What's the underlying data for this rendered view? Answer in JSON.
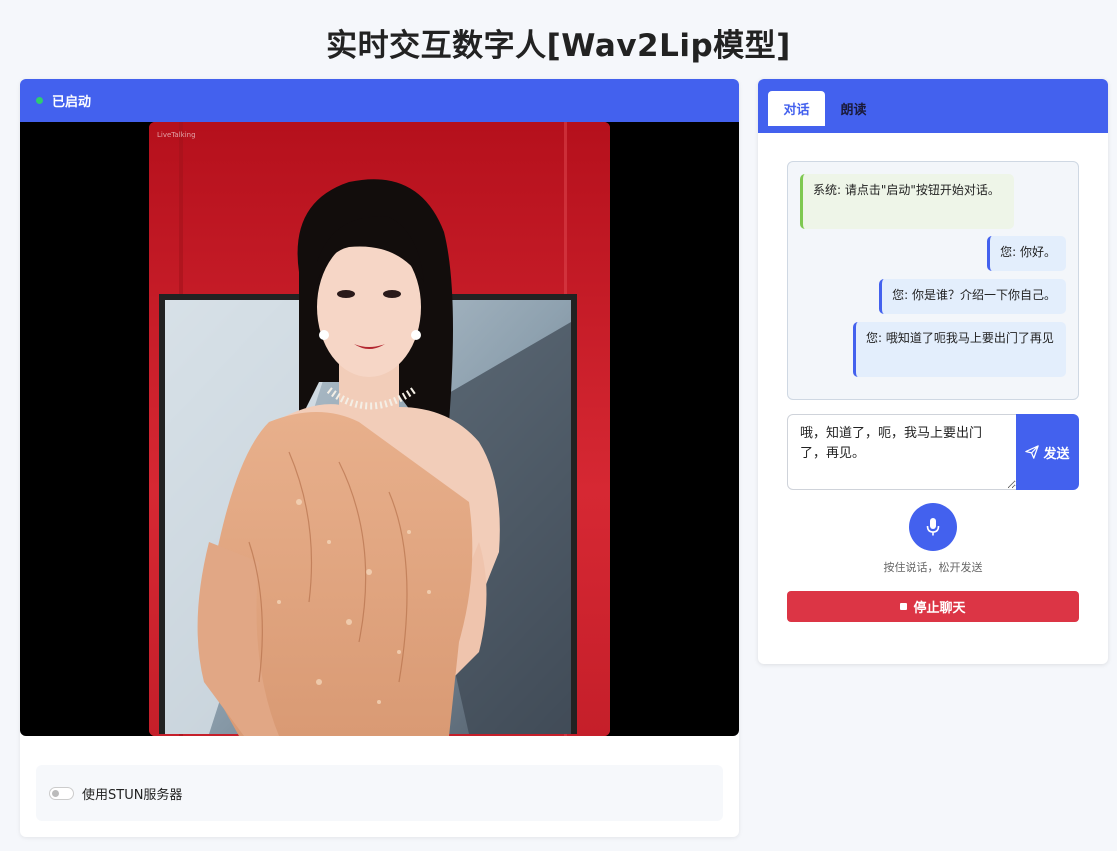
{
  "page": {
    "title": "实时交互数字人[Wav2Lip模型]"
  },
  "status": {
    "label": "已启动",
    "dot_color": "#2ecc71"
  },
  "video": {
    "watermark": "LiveTalking"
  },
  "stun": {
    "label": "使用STUN服务器",
    "enabled": false
  },
  "tabs": [
    {
      "label": "对话",
      "active": true
    },
    {
      "label": "朗读",
      "active": false
    }
  ],
  "chat": {
    "messages": [
      {
        "role": "system",
        "text": "系统: 请点击\"启动\"按钮开始对话。"
      },
      {
        "role": "user",
        "text": "您: 你好。"
      },
      {
        "role": "user",
        "text": "您: 你是谁？介绍一下你自己。"
      },
      {
        "role": "user",
        "text": "您: 哦知道了呃我马上要出门了再见"
      }
    ]
  },
  "input": {
    "value": "哦，知道了，呃，我马上要出门了，再见。"
  },
  "send_button": {
    "label": "发送",
    "icon": "paper-plane-icon"
  },
  "mic": {
    "icon": "microphone-icon",
    "hint": "按住说话，松开发送"
  },
  "stop_button": {
    "label": "停止聊天",
    "icon": "stop-icon"
  },
  "colors": {
    "accent": "#4361ee",
    "danger": "#dc3545",
    "system_border": "#7ec850"
  }
}
